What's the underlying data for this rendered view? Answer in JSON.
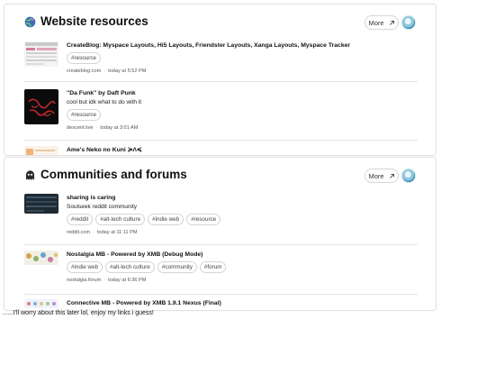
{
  "sections": [
    {
      "title": "Website resources",
      "icon": "globe-icon",
      "more_label": "More",
      "items": [
        {
          "title": "CreateBlog: Myspace Layouts, Hi5 Layouts, Friendster Layouts, Xanga Layouts, Myspace Tracker",
          "description": "",
          "tags": [
            "#resource"
          ],
          "domain": "createblog.com",
          "time": "today at 5:52 PM"
        },
        {
          "title": "\"Da Funk\" by Daft Punk",
          "description": "cool but idk what to do with it",
          "tags": [
            "#resource"
          ],
          "domain": "descent.live",
          "time": "today at 3:01 AM"
        },
        {
          "title": "Ame's Neko no Kuni ≽Ʌ≼",
          "description": "",
          "tags": [],
          "domain": "",
          "time": ""
        }
      ]
    },
    {
      "title": "Communities and forums",
      "icon": "ghost-icon",
      "more_label": "More",
      "items": [
        {
          "title": "sharing is caring",
          "description": "Soulseek reddit community",
          "tags": [
            "#reddit",
            "#alt-tech culture",
            "#indie web",
            "#resource"
          ],
          "domain": "reddit.com",
          "time": "today at 11:11 PM"
        },
        {
          "title": "Nostalgia MB - Powered by XMB (Debug Mode)",
          "description": "",
          "tags": [
            "#indie web",
            "#alt-tech culture",
            "#community",
            "#forum"
          ],
          "domain": "nostalgia.forum",
          "time": "today at 6:36 PM"
        },
        {
          "title": "Connective MB - Powered by XMB 1.9.1 Nexus (Final)",
          "description": "",
          "tags": [],
          "domain": "",
          "time": ""
        }
      ]
    }
  ],
  "footer_note": "......I'll worry about this later lol, enjoy my links i guess!",
  "colors": {
    "border": "#e3e3e3",
    "tag_border": "#d4d4d4",
    "meta_text": "#555555"
  }
}
